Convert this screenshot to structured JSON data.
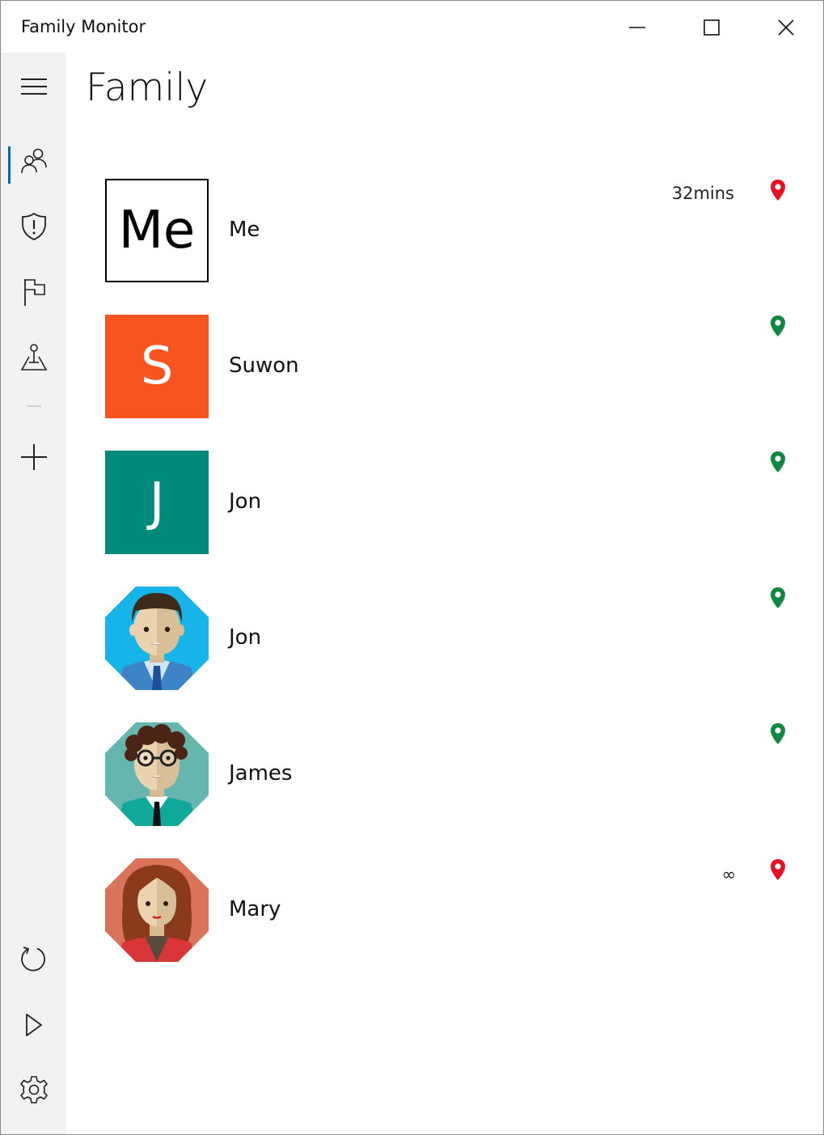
{
  "window": {
    "title": "Family Monitor"
  },
  "page": {
    "title": "Family"
  },
  "nav": {
    "items": [
      {
        "icon": "hamburger-menu-icon"
      },
      {
        "icon": "family-people-icon",
        "active": true
      },
      {
        "icon": "shield-alert-icon"
      },
      {
        "icon": "flag-icon"
      },
      {
        "icon": "map-pin-area-icon"
      },
      {
        "icon": "add-icon"
      }
    ],
    "bottom_items": [
      {
        "icon": "refresh-icon"
      },
      {
        "icon": "play-icon"
      },
      {
        "icon": "settings-gear-icon"
      }
    ]
  },
  "members": [
    {
      "name": "Me",
      "avatar_type": "initials",
      "initials": "Me",
      "avatar_bg": "#ffffff",
      "avatar_fg": "#000000",
      "avatar_border": true,
      "status": "32mins",
      "pin_color": "#e81123"
    },
    {
      "name": "Suwon",
      "avatar_type": "initials",
      "initials": "S",
      "avatar_bg": "#f7541f",
      "avatar_fg": "#ffffff",
      "avatar_border": false,
      "status": "",
      "pin_color": "#10893e"
    },
    {
      "name": "Jon",
      "avatar_type": "initials",
      "initials": "J",
      "avatar_bg": "#008a7a",
      "avatar_fg": "#ffffff",
      "avatar_border": false,
      "status": "",
      "pin_color": "#10893e"
    },
    {
      "name": "Jon",
      "avatar_type": "illustration",
      "illustration": "man-blue-suit",
      "avatar_bg": "#16b4e8",
      "status": "",
      "pin_color": "#10893e"
    },
    {
      "name": "James",
      "avatar_type": "illustration",
      "illustration": "man-glasses-teal",
      "avatar_bg": "#66b6b0",
      "status": "",
      "pin_color": "#10893e"
    },
    {
      "name": "Mary",
      "avatar_type": "illustration",
      "illustration": "woman-red-hair",
      "avatar_bg": "#d9735a",
      "status": "∞",
      "pin_color": "#e81123"
    }
  ]
}
